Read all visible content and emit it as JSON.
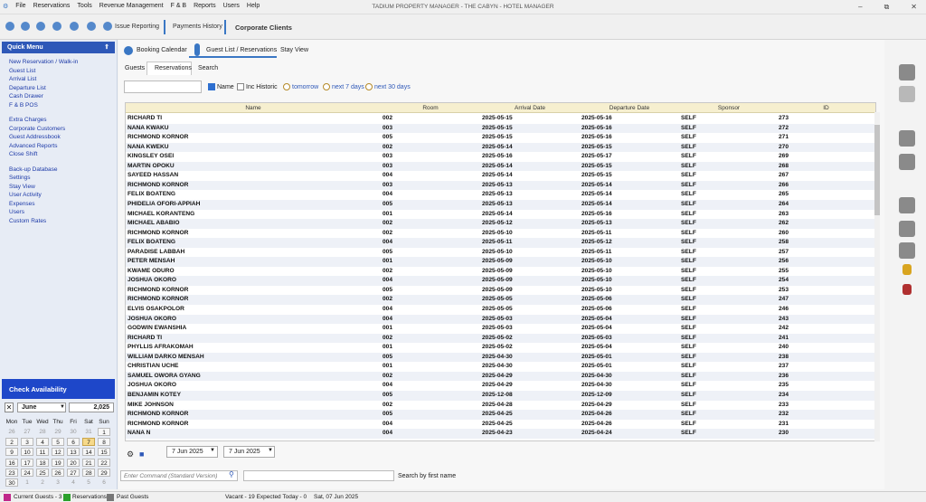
{
  "app_title": "TADIUM PROPERTY MANAGER - THE CABYN - HOTEL MANAGER",
  "menu": [
    "File",
    "Reservations",
    "Tools",
    "Revenue Management",
    "F & B",
    "Reports",
    "Users",
    "Help"
  ],
  "toolbar": {
    "issue_reporting": "Issue Reporting",
    "payments_history": "Payments History",
    "corporate_clients": "Corporate Clients"
  },
  "sidebar": {
    "quick_menu": "Quick Menu",
    "group1": [
      "New Reservation / Walk-in",
      "Guest List",
      "Arrival List",
      "Departure List",
      "Cash Drawer",
      "F & B POS"
    ],
    "group2": [
      "Extra Charges",
      "Corporate Customers",
      "Guest Addressbook",
      "Advanced Reports",
      "Close Shift"
    ],
    "group3": [
      "Back-up Database",
      "Settings",
      "Stay View",
      "User Activity",
      "Expenses",
      "Users",
      "Custom Rates"
    ]
  },
  "calendar": {
    "title": "Check Availability",
    "month": "June",
    "year": "2,025",
    "days": [
      "Mon",
      "Tue",
      "Wed",
      "Thu",
      "Fri",
      "Sat",
      "Sun"
    ],
    "weeks": [
      [
        "26",
        "27",
        "28",
        "29",
        "30",
        "31",
        "1"
      ],
      [
        "2",
        "3",
        "4",
        "5",
        "6",
        "7",
        "8"
      ],
      [
        "9",
        "10",
        "11",
        "12",
        "13",
        "14",
        "15"
      ],
      [
        "16",
        "17",
        "18",
        "19",
        "20",
        "21",
        "22"
      ],
      [
        "23",
        "24",
        "25",
        "26",
        "27",
        "28",
        "29"
      ],
      [
        "30",
        "1",
        "2",
        "3",
        "4",
        "5",
        "6"
      ]
    ],
    "today": "7"
  },
  "top_tabs": [
    "Booking Calendar",
    "Guest List / Reservations",
    "Stay View"
  ],
  "sub_tabs": [
    "Guests",
    "Reservations",
    "Search"
  ],
  "filters": {
    "name": "Name",
    "inc_historic": "Inc Historic",
    "tomorrow": "tomorrow",
    "next7": "next 7 days",
    "next30": "next 30 days"
  },
  "table": {
    "columns": [
      "Name",
      "Room",
      "Arrival Date",
      "Departure Date",
      "Sponsor",
      "ID"
    ],
    "rows": [
      [
        "RICHARD TI",
        "002",
        "2025-05-15",
        "2025-05-16",
        "SELF",
        "273"
      ],
      [
        "NANA KWAKU",
        "003",
        "2025-05-15",
        "2025-05-16",
        "SELF",
        "272"
      ],
      [
        "RICHMOND KORNOR",
        "005",
        "2025-05-15",
        "2025-05-16",
        "SELF",
        "271"
      ],
      [
        "NANA KWEKU",
        "002",
        "2025-05-14",
        "2025-05-15",
        "SELF",
        "270"
      ],
      [
        "KINGSLEY OSEI",
        "003",
        "2025-05-16",
        "2025-05-17",
        "SELF",
        "269"
      ],
      [
        "MARTIN OPOKU",
        "003",
        "2025-05-14",
        "2025-05-15",
        "SELF",
        "268"
      ],
      [
        "SAYEED  HASSAN",
        "004",
        "2025-05-14",
        "2025-05-15",
        "SELF",
        "267"
      ],
      [
        "RICHMOND KORNOR",
        "003",
        "2025-05-13",
        "2025-05-14",
        "SELF",
        "266"
      ],
      [
        "FELIX  BOATENG",
        "004",
        "2025-05-13",
        "2025-05-14",
        "SELF",
        "265"
      ],
      [
        "PHIDELIA  OFORI-APPIAH",
        "005",
        "2025-05-13",
        "2025-05-14",
        "SELF",
        "264"
      ],
      [
        "MICHAEL KORANTENG",
        "001",
        "2025-05-14",
        "2025-05-16",
        "SELF",
        "263"
      ],
      [
        "MICHAEL ABABIO",
        "002",
        "2025-05-12",
        "2025-05-13",
        "SELF",
        "262"
      ],
      [
        "RICHMOND KORNOR",
        "002",
        "2025-05-10",
        "2025-05-11",
        "SELF",
        "260"
      ],
      [
        "FELIX  BOATENG",
        "004",
        "2025-05-11",
        "2025-05-12",
        "SELF",
        "258"
      ],
      [
        "PARADISE LABBAH",
        "005",
        "2025-05-10",
        "2025-05-11",
        "SELF",
        "257"
      ],
      [
        "PETER MENSAH",
        "001",
        "2025-05-09",
        "2025-05-10",
        "SELF",
        "256"
      ],
      [
        "KWAME ODURO",
        "002",
        "2025-05-09",
        "2025-05-10",
        "SELF",
        "255"
      ],
      [
        "JOSHUA OKORO",
        "004",
        "2025-05-09",
        "2025-05-10",
        "SELF",
        "254"
      ],
      [
        "RICHMOND KORNOR",
        "005",
        "2025-05-09",
        "2025-05-10",
        "SELF",
        "253"
      ],
      [
        "RICHMOND KORNOR",
        "002",
        "2025-05-05",
        "2025-05-06",
        "SELF",
        "247"
      ],
      [
        "ELVIS OSAKPOLOR",
        "004",
        "2025-05-05",
        "2025-05-06",
        "SELF",
        "246"
      ],
      [
        "JOSHUA OKORO",
        "004",
        "2025-05-03",
        "2025-05-04",
        "SELF",
        "243"
      ],
      [
        "GODWIN EWANSHIA",
        "001",
        "2025-05-03",
        "2025-05-04",
        "SELF",
        "242"
      ],
      [
        "RICHARD TI",
        "002",
        "2025-05-02",
        "2025-05-03",
        "SELF",
        "241"
      ],
      [
        "PHYLLIS AFRAKOMAH",
        "001",
        "2025-05-02",
        "2025-05-04",
        "SELF",
        "240"
      ],
      [
        "WILLIAM DARKO MENSAH",
        "005",
        "2025-04-30",
        "2025-05-01",
        "SELF",
        "238"
      ],
      [
        "CHRISTIAN UCHE",
        "001",
        "2025-04-30",
        "2025-05-01",
        "SELF",
        "237"
      ],
      [
        "SAMUEL OWORA GYANG",
        "002",
        "2025-04-29",
        "2025-04-30",
        "SELF",
        "236"
      ],
      [
        "JOSHUA OKORO",
        "004",
        "2025-04-29",
        "2025-04-30",
        "SELF",
        "235"
      ],
      [
        "BENJAMIN KOTEY",
        "005",
        "2025-12-08",
        "2025-12-09",
        "SELF",
        "234"
      ],
      [
        "MIKE JOHNSON",
        "002",
        "2025-04-28",
        "2025-04-29",
        "SELF",
        "233"
      ],
      [
        "RICHMOND KORNOR",
        "005",
        "2025-04-25",
        "2025-04-26",
        "SELF",
        "232"
      ],
      [
        "RICHMOND KORNOR",
        "004",
        "2025-04-25",
        "2025-04-26",
        "SELF",
        "231"
      ],
      [
        "NANA N",
        "004",
        "2025-04-23",
        "2025-04-24",
        "SELF",
        "230"
      ]
    ]
  },
  "date_from": "7 Jun 2025",
  "date_to": "7 Jun 2025",
  "command_placeholder": "Enter Command (Standard Version)",
  "search_hint": "Search by first name",
  "status": {
    "current_guests": "Current Guests - 3",
    "reservations": "Reservations",
    "past_guests": "Past Guests",
    "summary": "Vacant - 19  Expected Today - 0",
    "date": "Sat, 07 Jun 2025"
  }
}
